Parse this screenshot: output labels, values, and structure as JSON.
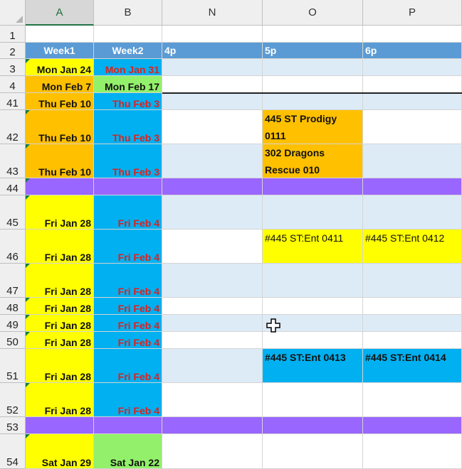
{
  "columns": [
    "A",
    "B",
    "N",
    "O",
    "P"
  ],
  "row_numbers": [
    "1",
    "2",
    "3",
    "4",
    "41",
    "42",
    "43",
    "44",
    "45",
    "46",
    "47",
    "48",
    "49",
    "50",
    "51",
    "52",
    "53",
    "54"
  ],
  "header_row": {
    "week1": "Week1",
    "week2": "Week2",
    "n": "4p",
    "o": "5p",
    "p": "6p"
  },
  "rows": {
    "r3": {
      "a": "Mon Jan 24",
      "b": "Mon Jan 31"
    },
    "r4": {
      "a": "Mon Feb 7",
      "b": "Mon Feb 17"
    },
    "r41": {
      "a": "Thu Feb 10",
      "b": "Thu Feb 3"
    },
    "r42": {
      "a": "Thu Feb 10",
      "b": "Thu Feb 3"
    },
    "r43": {
      "a": "Thu Feb 10",
      "b": "Thu Feb 3"
    },
    "r45": {
      "a": "Fri Jan 28",
      "b": "Fri Feb 4"
    },
    "r46": {
      "a": "Fri Jan 28",
      "b": "Fri Feb 4"
    },
    "r47": {
      "a": "Fri Jan 28",
      "b": "Fri Feb 4"
    },
    "r48": {
      "a": "Fri Jan 28",
      "b": "Fri Feb 4"
    },
    "r49": {
      "a": "Fri Jan 28",
      "b": "Fri Feb 4"
    },
    "r50": {
      "a": "Fri Jan 28",
      "b": "Fri Feb 4"
    },
    "r51": {
      "a": "Fri Jan 28",
      "b": "Fri Feb 4"
    },
    "r52": {
      "a": "Fri Jan 28",
      "b": "Fri Feb 4"
    },
    "r54": {
      "a": "Sat Jan 29",
      "b": "Sat Jan 22"
    }
  },
  "events": {
    "e42_line1": "445 ST Prodigy",
    "e42_line2": "0111",
    "e43_line1": "302 Dragons",
    "e43_line2": "Rescue 010",
    "e46_o": "#445 ST:Ent 0411",
    "e46_p": "#445 ST:Ent 0412",
    "e51_o": "#445 ST:Ent 0413",
    "e51_p": "#445 ST:Ent 0414"
  },
  "colors": {
    "header_blue": "#5b9bd5",
    "light_blue": "#ddebf7",
    "yellow": "#ffff00",
    "orange": "#ffc000",
    "sky": "#00b0f0",
    "green": "#92f06a",
    "purple": "#9966ff",
    "red_text": "#e0201c"
  }
}
